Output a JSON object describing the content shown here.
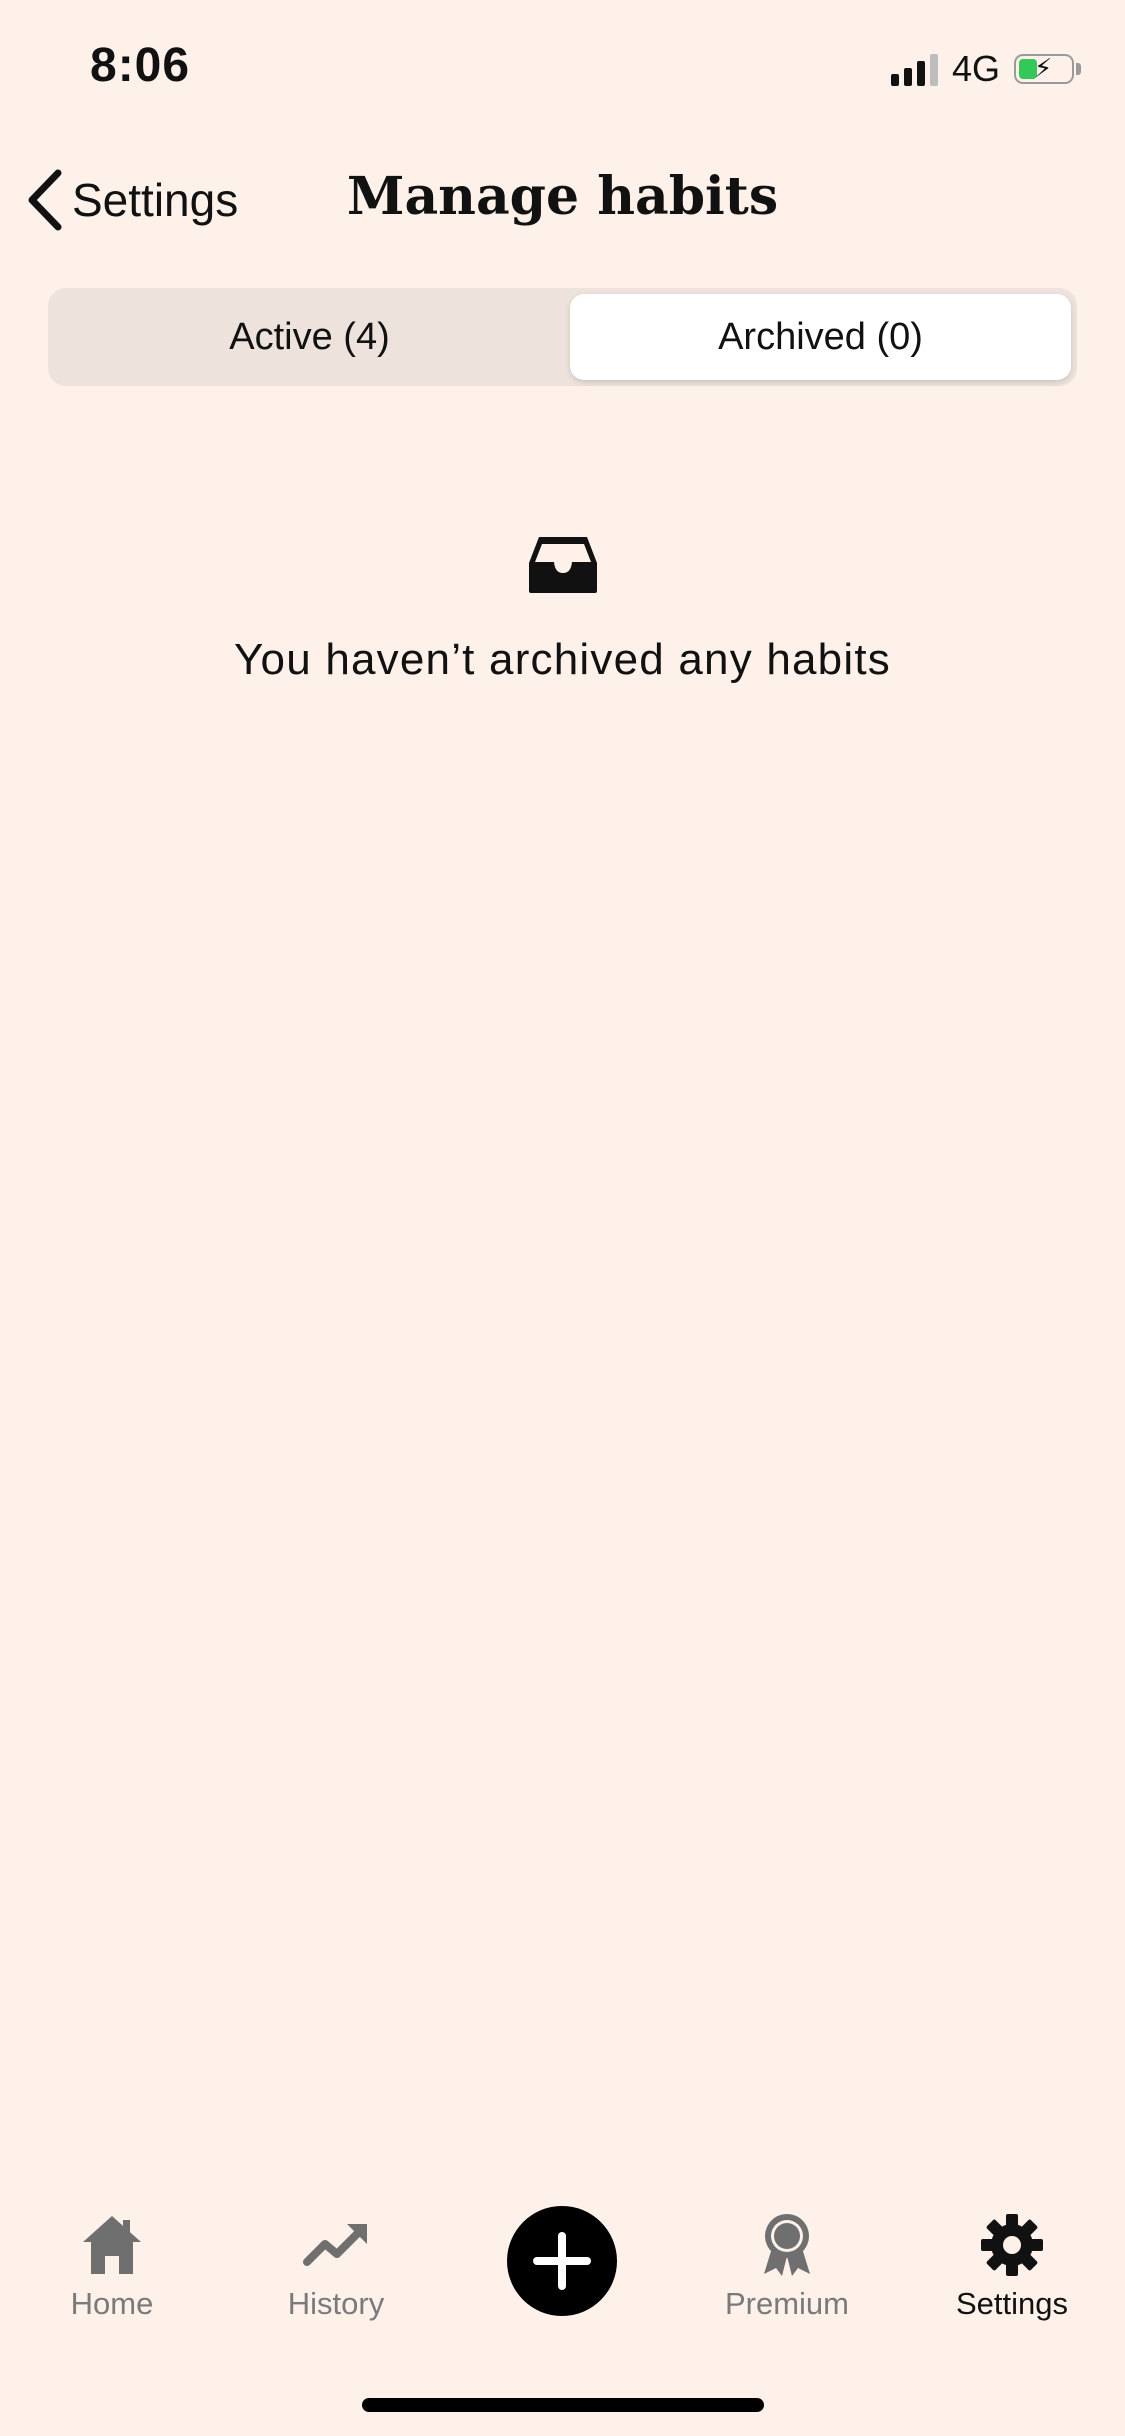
{
  "status_bar": {
    "time": "8:06",
    "network": "4G"
  },
  "nav": {
    "back_label": "Settings",
    "title": "Manage habits"
  },
  "tabs": [
    {
      "label": "Active (4)",
      "selected": false
    },
    {
      "label": "Archived (0)",
      "selected": true
    }
  ],
  "empty_state": {
    "icon": "inbox-tray-icon",
    "message": "You haven’t archived any habits"
  },
  "tab_bar": {
    "items": [
      {
        "label": "Home",
        "icon": "home-icon"
      },
      {
        "label": "History",
        "icon": "trend-up-icon"
      },
      {
        "label": "Premium",
        "icon": "award-ribbon-icon"
      },
      {
        "label": "Settings",
        "icon": "gear-icon",
        "selected": true
      }
    ],
    "add_icon": "plus-icon"
  },
  "colors": {
    "background": "#fdf1ea",
    "segment_track": "#ede2dc",
    "segment_selected": "#ffffff",
    "inactive_icon": "#7a7a7a",
    "active_icon": "#111111",
    "battery_charge": "#34c759"
  }
}
